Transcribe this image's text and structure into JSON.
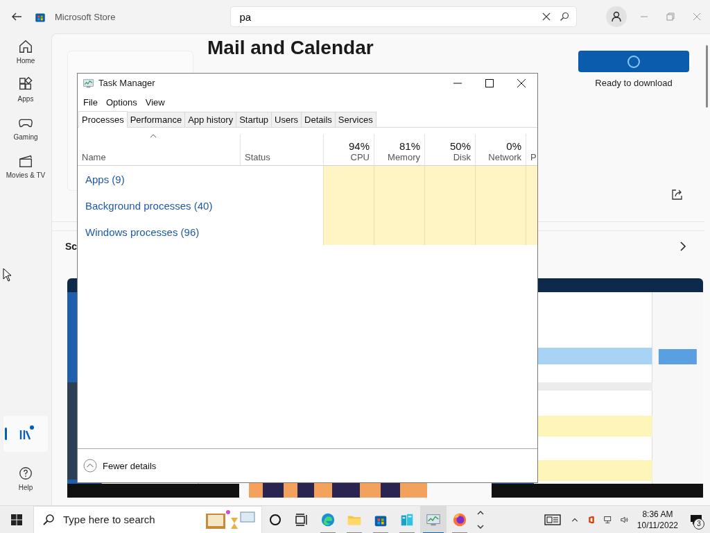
{
  "store": {
    "title": "Microsoft Store",
    "search": {
      "value": "pa"
    },
    "nav": [
      {
        "kind": "home",
        "label": "Home",
        "selected": false
      },
      {
        "kind": "apps",
        "label": "Apps",
        "selected": false
      },
      {
        "kind": "gaming",
        "label": "Gaming",
        "selected": false
      },
      {
        "kind": "movies",
        "label": "Movies & TV",
        "selected": false
      }
    ],
    "library": {
      "selected": true,
      "update_dot": true
    },
    "help": {
      "label": "Help"
    },
    "app": {
      "title": "Mail and Calendar",
      "status": "Ready to download"
    },
    "section": {
      "title": "Sc"
    }
  },
  "task_manager": {
    "title": "Task Manager",
    "menu": [
      "File",
      "Options",
      "View"
    ],
    "tabs": [
      {
        "label": "Processes",
        "selected": true
      },
      {
        "label": "Performance",
        "selected": false
      },
      {
        "label": "App history",
        "selected": false
      },
      {
        "label": "Startup",
        "selected": false
      },
      {
        "label": "Users",
        "selected": false
      },
      {
        "label": "Details",
        "selected": false
      },
      {
        "label": "Services",
        "selected": false
      }
    ],
    "columns": [
      {
        "label": "Name"
      },
      {
        "label": "Status"
      },
      {
        "percent": "94%",
        "label": "CPU"
      },
      {
        "percent": "81%",
        "label": "Memory"
      },
      {
        "percent": "50%",
        "label": "Disk"
      },
      {
        "percent": "0%",
        "label": "Network"
      },
      {
        "label": "P"
      }
    ],
    "groups": [
      "Apps (9)",
      "Background processes (40)",
      "Windows processes (96)"
    ],
    "footer": "Fewer details"
  },
  "taskbar": {
    "search": {
      "placeholder": "Type here to search"
    },
    "apps": [
      {
        "kind": "edge",
        "selected": false
      },
      {
        "kind": "explorer",
        "selected": false
      },
      {
        "kind": "store",
        "selected": false
      },
      {
        "kind": "server",
        "selected": false
      },
      {
        "kind": "taskmgr",
        "selected": true
      },
      {
        "kind": "firefox",
        "selected": false
      }
    ],
    "time": "8:36 AM",
    "date": "10/11/2022",
    "notifications": "3"
  }
}
